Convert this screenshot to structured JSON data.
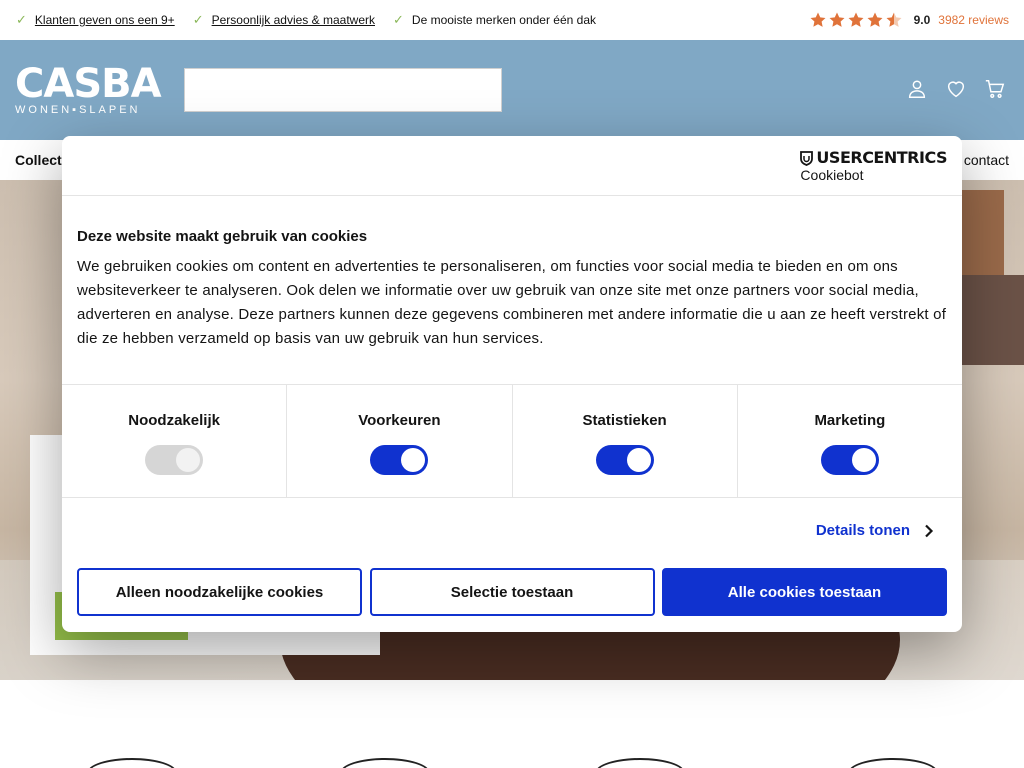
{
  "usp": [
    {
      "text": "Klanten geven ons een 9+",
      "link": true
    },
    {
      "text": "Persoonlijk advies & maatwerk",
      "link": true
    },
    {
      "text": "De mooiste merken onder één dak",
      "link": false
    }
  ],
  "rating": {
    "stars": 4.5,
    "score": "9.0",
    "reviews": "3982 reviews"
  },
  "logo": {
    "main": "CASBA",
    "sub": "WONEN▪SLAPEN"
  },
  "header": {
    "search_value": "",
    "icons": [
      "user-icon",
      "heart-icon",
      "cart-icon"
    ]
  },
  "nav": {
    "left": "Collect",
    "right": "contact"
  },
  "colors": {
    "accent": "#1032cf",
    "header_bg": "#80a8c5",
    "rating": "#e0733a",
    "check": "#8bb85a"
  },
  "cookie": {
    "brand_top": "USERCENTRICS",
    "brand_bottom": "Cookiebot",
    "title": "Deze website maakt gebruik van cookies",
    "text": "We gebruiken cookies om content en advertenties te personaliseren, om functies voor social media te bieden en om ons websiteverkeer te analyseren. Ook delen we informatie over uw gebruik van onze site met onze partners voor social media, adverteren en analyse. Deze partners kunnen deze gegevens combineren met andere informatie die u aan ze heeft verstrekt of die ze hebben verzameld op basis van uw gebruik van hun services.",
    "categories": [
      {
        "label": "Noodzakelijk",
        "checked": true,
        "disabled": true
      },
      {
        "label": "Voorkeuren",
        "checked": true,
        "disabled": false
      },
      {
        "label": "Statistieken",
        "checked": true,
        "disabled": false
      },
      {
        "label": "Marketing",
        "checked": true,
        "disabled": false
      }
    ],
    "details_label": "Details tonen",
    "btn_necessary": "Alleen noodzakelijke cookies",
    "btn_selection": "Selectie toestaan",
    "btn_all": "Alle cookies toestaan"
  }
}
